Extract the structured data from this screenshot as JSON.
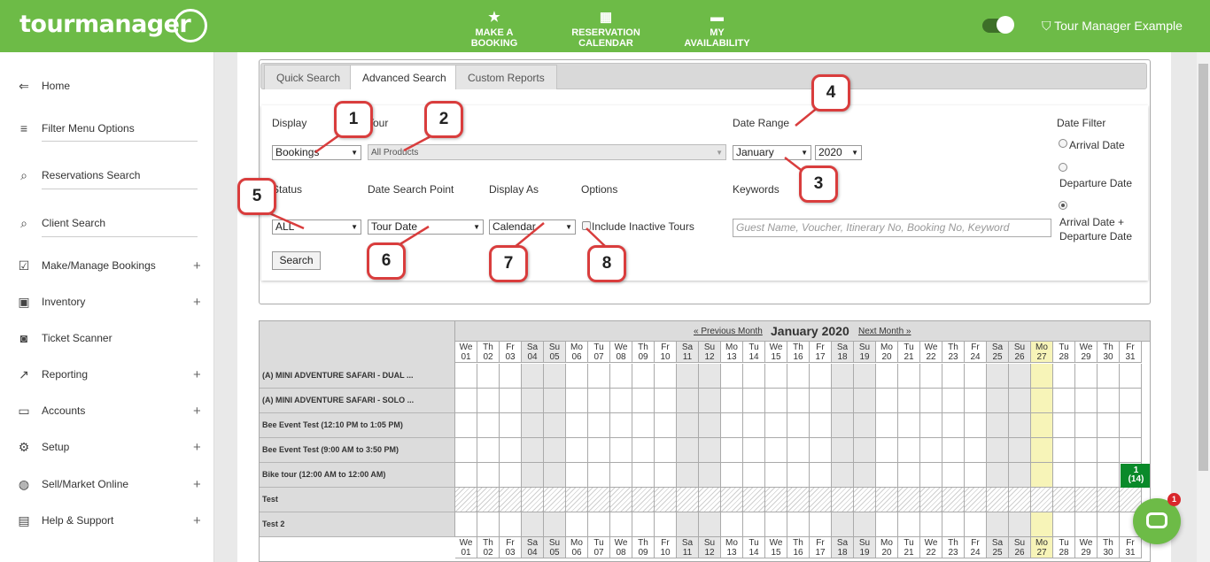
{
  "app": {
    "logo": "tourmanager",
    "nav": [
      {
        "label": "MAKE A BOOKING",
        "icon": "star-icon"
      },
      {
        "label": "RESERVATION CALENDAR",
        "icon": "calendar-icon"
      },
      {
        "label": "MY AVAILABILITY",
        "icon": "bed-icon"
      }
    ],
    "account": "Tour Manager Example",
    "brand_color": "#6dbb47"
  },
  "sidebar": {
    "items": [
      {
        "label": "Home",
        "icon": "home-arrow-icon",
        "expand": ""
      },
      {
        "label": "Filter Menu Options",
        "icon": "filter-icon",
        "expand": ""
      },
      {
        "label": "Reservations Search",
        "icon": "search-icon",
        "expand": ""
      },
      {
        "label": "Client Search",
        "icon": "search-icon",
        "expand": ""
      },
      {
        "label": "Make/Manage Bookings",
        "icon": "calendar-check-icon",
        "expand": "+"
      },
      {
        "label": "Inventory",
        "icon": "bus-icon",
        "expand": "+"
      },
      {
        "label": "Ticket Scanner",
        "icon": "scanner-icon",
        "expand": ""
      },
      {
        "label": "Reporting",
        "icon": "trending-icon",
        "expand": "+"
      },
      {
        "label": "Accounts",
        "icon": "card-icon",
        "expand": "+"
      },
      {
        "label": "Setup",
        "icon": "gear-icon",
        "expand": "+"
      },
      {
        "label": "Sell/Market Online",
        "icon": "globe-icon",
        "expand": "+"
      },
      {
        "label": "Help & Support",
        "icon": "chat-icon",
        "expand": "+"
      }
    ]
  },
  "search": {
    "tabs": [
      "Quick Search",
      "Advanced Search",
      "Custom Reports"
    ],
    "active_tab": "Advanced Search",
    "display_label": "Display",
    "display_value": "Bookings",
    "tour_label": "Tour",
    "tour_value": "All Products",
    "date_range_label": "Date Range",
    "month_value": "January",
    "year_value": "2020",
    "date_filter_label": "Date Filter",
    "date_filter_options": [
      "Arrival Date",
      "Departure Date",
      "Arrival Date + Departure Date"
    ],
    "date_filter_selected": "Arrival Date + Departure Date",
    "status_label": "Status",
    "status_value": "ALL",
    "date_search_point_label": "Date Search Point",
    "date_search_point_value": "Tour Date",
    "display_as_label": "Display As",
    "display_as_value": "Calendar",
    "options_label": "Options",
    "include_inactive_label": "Include Inactive Tours",
    "include_inactive_checked": false,
    "keywords_label": "Keywords",
    "keywords_placeholder": "Guest Name, Voucher, Itinerary No, Booking No, Keyword",
    "search_button": "Search"
  },
  "callouts": [
    "1",
    "2",
    "3",
    "4",
    "5",
    "6",
    "7",
    "8"
  ],
  "calendar": {
    "prev_label": "« Previous Month",
    "next_label": "Next Month »",
    "month_title": "January 2020",
    "days": [
      {
        "dow": "We",
        "d": "01"
      },
      {
        "dow": "Th",
        "d": "02"
      },
      {
        "dow": "Fr",
        "d": "03"
      },
      {
        "dow": "Sa",
        "d": "04"
      },
      {
        "dow": "Su",
        "d": "05"
      },
      {
        "dow": "Mo",
        "d": "06"
      },
      {
        "dow": "Tu",
        "d": "07"
      },
      {
        "dow": "We",
        "d": "08"
      },
      {
        "dow": "Th",
        "d": "09"
      },
      {
        "dow": "Fr",
        "d": "10"
      },
      {
        "dow": "Sa",
        "d": "11"
      },
      {
        "dow": "Su",
        "d": "12"
      },
      {
        "dow": "Mo",
        "d": "13"
      },
      {
        "dow": "Tu",
        "d": "14"
      },
      {
        "dow": "We",
        "d": "15"
      },
      {
        "dow": "Th",
        "d": "16"
      },
      {
        "dow": "Fr",
        "d": "17"
      },
      {
        "dow": "Sa",
        "d": "18"
      },
      {
        "dow": "Su",
        "d": "19"
      },
      {
        "dow": "Mo",
        "d": "20"
      },
      {
        "dow": "Tu",
        "d": "21"
      },
      {
        "dow": "We",
        "d": "22"
      },
      {
        "dow": "Th",
        "d": "23"
      },
      {
        "dow": "Fr",
        "d": "24"
      },
      {
        "dow": "Sa",
        "d": "25"
      },
      {
        "dow": "Su",
        "d": "26"
      },
      {
        "dow": "Mo",
        "d": "27"
      },
      {
        "dow": "Tu",
        "d": "28"
      },
      {
        "dow": "We",
        "d": "29"
      },
      {
        "dow": "Th",
        "d": "30"
      },
      {
        "dow": "Fr",
        "d": "31"
      }
    ],
    "today": "27",
    "rows": [
      {
        "name": "(A) MINI ADVENTURE SAFARI - DUAL ...",
        "hatched": false
      },
      {
        "name": "(A) MINI ADVENTURE SAFARI - SOLO ...",
        "hatched": false
      },
      {
        "name": "Bee Event Test (12:10 PM to 1:05 PM)",
        "hatched": false
      },
      {
        "name": "Bee Event Test (9:00 AM to 3:50 PM)",
        "hatched": false
      },
      {
        "name": "Bike tour (12:00 AM to 12:00 AM)",
        "hatched": false
      },
      {
        "name": "Test",
        "hatched": true
      },
      {
        "name": "Test 2",
        "hatched": false
      }
    ],
    "booking": {
      "row": "Bike tour (12:00 AM to 12:00 AM)",
      "day": "31",
      "count": "1",
      "pax": "(14)",
      "color": "#0a8a2a"
    }
  },
  "chat": {
    "badge": "1"
  }
}
